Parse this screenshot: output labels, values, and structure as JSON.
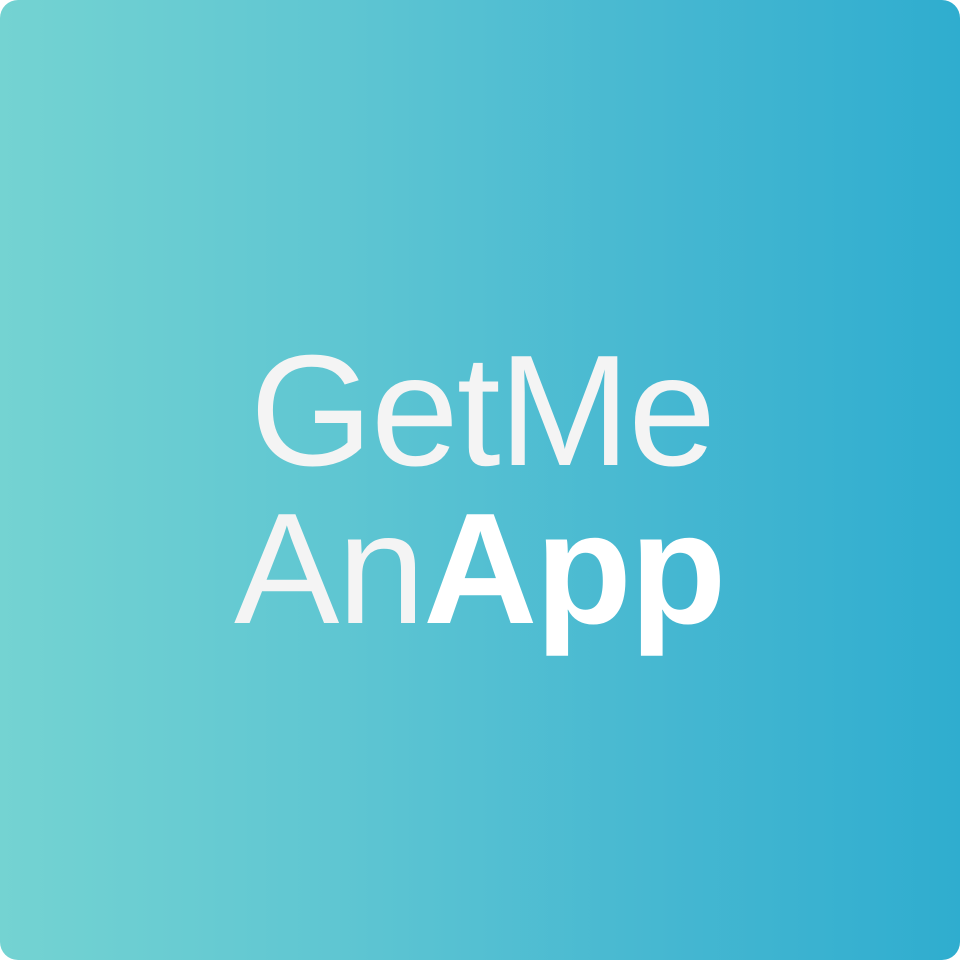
{
  "logo": {
    "line1": "GetMe",
    "line2_regular": "An",
    "line2_bold": "App"
  },
  "colors": {
    "gradient_start": "#74d3d2",
    "gradient_end": "#2fadcf",
    "text": "#f4f4f4"
  }
}
